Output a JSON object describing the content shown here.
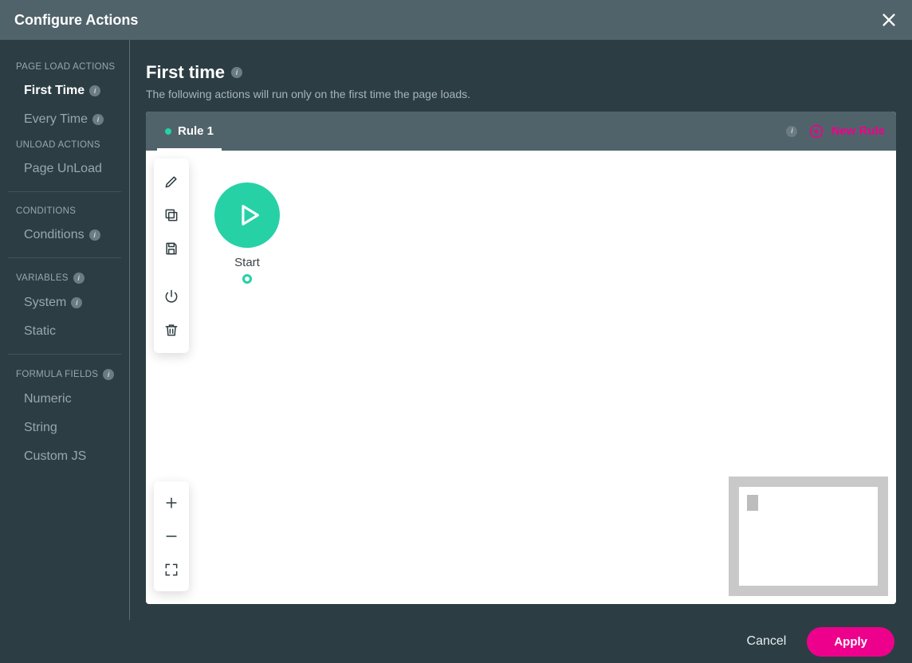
{
  "header": {
    "title": "Configure Actions"
  },
  "sidebar": {
    "sections": [
      {
        "label": "PAGE LOAD ACTIONS",
        "info": false,
        "items": [
          {
            "label": "First Time",
            "info": true,
            "active": true
          },
          {
            "label": "Every Time",
            "info": true,
            "active": false
          }
        ]
      },
      {
        "label": "UNLOAD ACTIONS",
        "info": false,
        "items": [
          {
            "label": "Page UnLoad",
            "info": false,
            "active": false
          }
        ],
        "hr_after": true
      },
      {
        "label": "CONDITIONS",
        "info": false,
        "items": [
          {
            "label": "Conditions",
            "info": true,
            "active": false
          }
        ],
        "hr_after": true
      },
      {
        "label": "VARIABLES",
        "info": true,
        "items": [
          {
            "label": "System",
            "info": true,
            "active": false
          },
          {
            "label": "Static",
            "info": false,
            "active": false
          }
        ],
        "hr_after": true
      },
      {
        "label": "FORMULA FIELDS",
        "info": true,
        "items": [
          {
            "label": "Numeric",
            "info": false,
            "active": false
          },
          {
            "label": "String",
            "info": false,
            "active": false
          },
          {
            "label": "Custom JS",
            "info": false,
            "active": false
          }
        ]
      }
    ]
  },
  "page": {
    "title": "First time",
    "subtitle": "The following actions will run only on the first time the page loads."
  },
  "tabs": {
    "active_rule": "Rule 1",
    "new_rule_label": "New Rule"
  },
  "canvas": {
    "start_label": "Start",
    "tool_icons": [
      "edit",
      "copy",
      "save",
      "power",
      "trash"
    ],
    "zoom_icons": [
      "plus",
      "minus",
      "fit"
    ]
  },
  "footer": {
    "cancel": "Cancel",
    "apply": "Apply"
  },
  "colors": {
    "accent_pink": "#ed018c",
    "accent_teal": "#26d1a6",
    "header_bg": "#51636a",
    "bg": "#2c3e44"
  }
}
